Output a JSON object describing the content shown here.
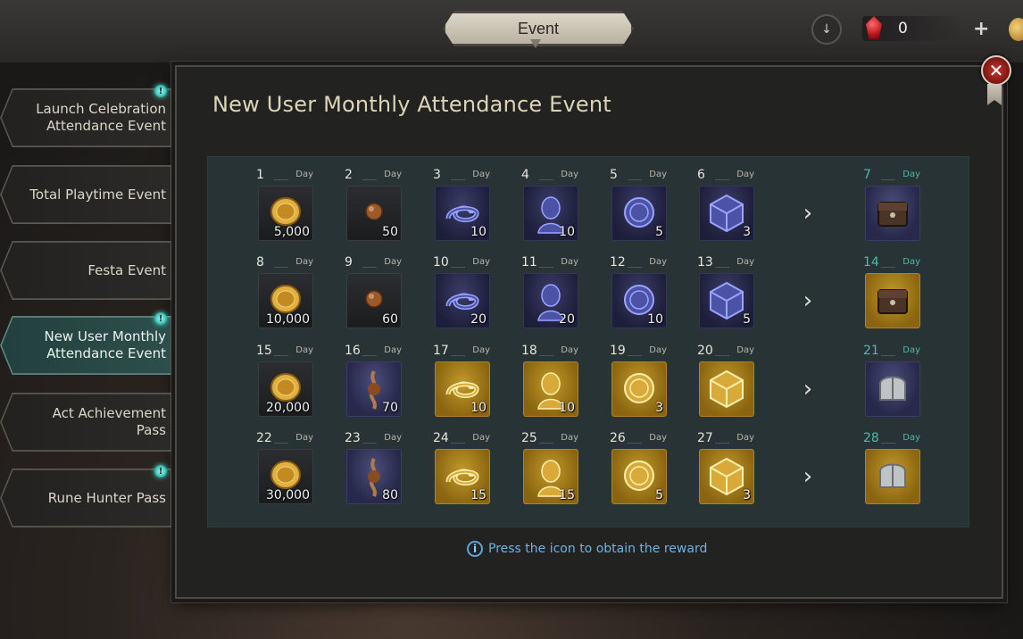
{
  "header": {
    "title": "Event",
    "gem_count": "0",
    "plus_label": "+"
  },
  "sidebar": {
    "items": [
      {
        "label": "Launch Celebration Attendance Event",
        "alert": true,
        "active": false
      },
      {
        "label": "Total Playtime Event",
        "alert": false,
        "active": false
      },
      {
        "label": "Festa Event",
        "alert": false,
        "active": false
      },
      {
        "label": "New User Monthly Attendance Event",
        "alert": true,
        "active": true
      },
      {
        "label": "Act Achievement Pass",
        "alert": false,
        "active": false
      },
      {
        "label": "Rune Hunter Pass",
        "alert": true,
        "active": false
      }
    ]
  },
  "panel": {
    "title": "New User Monthly Attendance Event",
    "day_label": "Day",
    "info_text": "Press the icon to obtain the reward",
    "rows": [
      {
        "days": [
          {
            "day": "1",
            "qty": "5,000",
            "icon": "gold-coin-icon",
            "bg": "dark"
          },
          {
            "day": "2",
            "qty": "50",
            "icon": "bronze-orb-icon",
            "bg": "dark"
          },
          {
            "day": "3",
            "qty": "10",
            "icon": "blue-serpent-icon",
            "bg": "purple"
          },
          {
            "day": "4",
            "qty": "10",
            "icon": "blue-bust-icon",
            "bg": "purple"
          },
          {
            "day": "5",
            "qty": "5",
            "icon": "blue-medallion-icon",
            "bg": "purple"
          },
          {
            "day": "6",
            "qty": "3",
            "icon": "blue-cube-icon",
            "bg": "purple"
          }
        ],
        "reward": {
          "day": "7",
          "icon": "treasure-chest-icon",
          "bg": "blue"
        }
      },
      {
        "days": [
          {
            "day": "8",
            "qty": "10,000",
            "icon": "gold-coin-icon",
            "bg": "dark"
          },
          {
            "day": "9",
            "qty": "60",
            "icon": "bronze-orb-icon",
            "bg": "dark"
          },
          {
            "day": "10",
            "qty": "20",
            "icon": "blue-serpent-icon",
            "bg": "purple"
          },
          {
            "day": "11",
            "qty": "20",
            "icon": "blue-bust-icon",
            "bg": "purple"
          },
          {
            "day": "12",
            "qty": "10",
            "icon": "blue-medallion-icon",
            "bg": "purple"
          },
          {
            "day": "13",
            "qty": "5",
            "icon": "blue-cube-icon",
            "bg": "purple"
          }
        ],
        "reward": {
          "day": "14",
          "icon": "treasure-chest-icon",
          "bg": "gold"
        }
      },
      {
        "days": [
          {
            "day": "15",
            "qty": "20,000",
            "icon": "gold-coin-icon",
            "bg": "dark"
          },
          {
            "day": "16",
            "qty": "70",
            "icon": "bronze-root-icon",
            "bg": "blue"
          },
          {
            "day": "17",
            "qty": "10",
            "icon": "gold-serpent-icon",
            "bg": "gold"
          },
          {
            "day": "18",
            "qty": "10",
            "icon": "gold-bust-icon",
            "bg": "gold"
          },
          {
            "day": "19",
            "qty": "3",
            "icon": "gold-medallion-icon",
            "bg": "gold"
          },
          {
            "day": "20",
            "qty": "",
            "icon": "gold-cube-icon",
            "bg": "gold"
          }
        ],
        "reward": {
          "day": "21",
          "icon": "silver-helmet-icon",
          "bg": "blue"
        }
      },
      {
        "days": [
          {
            "day": "22",
            "qty": "30,000",
            "icon": "gold-coin-icon",
            "bg": "dark"
          },
          {
            "day": "23",
            "qty": "80",
            "icon": "bronze-root-icon",
            "bg": "blue"
          },
          {
            "day": "24",
            "qty": "15",
            "icon": "gold-serpent-icon",
            "bg": "gold"
          },
          {
            "day": "25",
            "qty": "15",
            "icon": "gold-bust-icon",
            "bg": "gold"
          },
          {
            "day": "26",
            "qty": "5",
            "icon": "gold-medallion-icon",
            "bg": "gold"
          },
          {
            "day": "27",
            "qty": "3",
            "icon": "gold-cube-icon",
            "bg": "gold"
          }
        ],
        "reward": {
          "day": "28",
          "icon": "silver-helmet-icon",
          "bg": "gold"
        }
      }
    ]
  },
  "colors": {
    "accent_teal": "#4fb8b0",
    "info_blue": "#6fb3e0",
    "gold": "#c29a2a"
  }
}
